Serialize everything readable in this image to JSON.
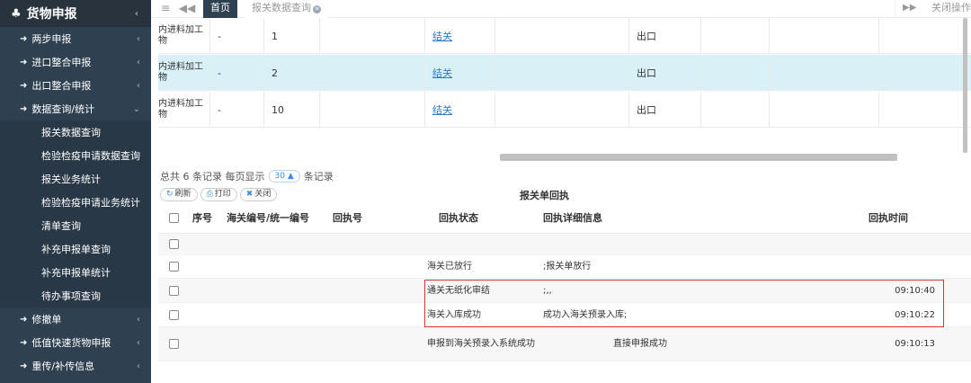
{
  "sidebar": {
    "title": "货物申报",
    "items": [
      {
        "label": "两步申报"
      },
      {
        "label": "进口整合申报"
      },
      {
        "label": "出口整合申报"
      },
      {
        "label": "数据查询/统计"
      }
    ],
    "subitems": [
      {
        "label": "报关数据查询"
      },
      {
        "label": "检验检疫申请数据查询"
      },
      {
        "label": "报关业务统计"
      },
      {
        "label": "检验检疫申请业务统计"
      },
      {
        "label": "清单查询"
      },
      {
        "label": "补充申报单查询"
      },
      {
        "label": "补充申报单统计"
      },
      {
        "label": "待办事项查询"
      }
    ],
    "items_after": [
      {
        "label": "修撤单"
      },
      {
        "label": "低值快速货物申报"
      },
      {
        "label": "重传/补传信息"
      }
    ]
  },
  "topbar": {
    "home_tab": "首页",
    "query_tab": "报关数据查询",
    "close_ops": "关闭操作"
  },
  "grid": {
    "rows": [
      {
        "c0": "内进料加工\n物",
        "c1": "-",
        "c2": "1",
        "c4": "结关",
        "c6": "出口"
      },
      {
        "c0": "内进料加工\n物",
        "c1": "-",
        "c2": "2",
        "c4": "结关",
        "c6": "出口"
      },
      {
        "c0": "内进料加工\n物",
        "c1": "-",
        "c2": "10",
        "c4": "结关",
        "c6": "出口"
      }
    ]
  },
  "pager": {
    "prefix": "总共 6 条记录 每页显示",
    "size": "30",
    "suffix": "条记录"
  },
  "buttons": {
    "refresh": "刷新",
    "print": "打印",
    "close": "关闭"
  },
  "receipt": {
    "title": "报关单回执",
    "headers": {
      "seq": "序号",
      "customs_no": "海关编号/统一编号",
      "receipt_no": "回执号",
      "status": "回执状态",
      "detail": "回执详细信息",
      "time": "回执时间"
    },
    "rows": [
      {
        "status": "",
        "detail": "",
        "time": ""
      },
      {
        "status": "海关已放行",
        "detail": ";报关单放行",
        "time": ""
      },
      {
        "status": "通关无纸化审结",
        "detail": ";,,",
        "time": "09:10:40"
      },
      {
        "status": "海关入库成功",
        "detail": "成功入海关预录入库;",
        "time": "09:10:22"
      },
      {
        "status": "申报到海关预录入系统成功",
        "detail": "直接申报成功",
        "time": "09:10:13"
      }
    ]
  }
}
